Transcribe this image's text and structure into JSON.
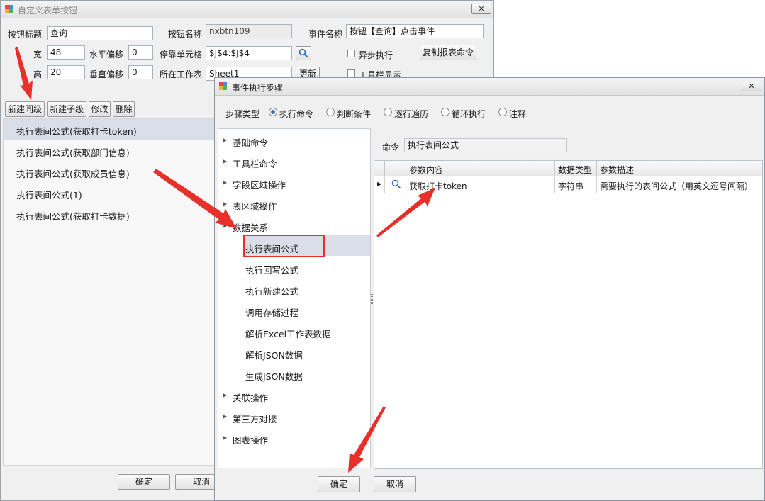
{
  "bg_window": {
    "title": "自定义表单按钮",
    "close": "✕",
    "fields": {
      "caption_label": "按钮标题",
      "caption_value": "查询",
      "name_label": "按钮名称",
      "name_value": "nxbtn109",
      "event_label": "事件名称",
      "event_value": "按钮【查询】点击事件",
      "width_label": "宽",
      "width_value": "48",
      "hoffset_label": "水平偏移",
      "hoffset_value": "0",
      "dock_label": "停靠单元格",
      "dock_value": "$J$4:$J$4",
      "async_label": "异步执行",
      "copy_cmd_label": "复制报表命令",
      "height_label": "高",
      "height_value": "20",
      "voffset_label": "垂直偏移",
      "voffset_value": "0",
      "sheet_label": "所在工作表",
      "sheet_value": "Sheet1",
      "refresh_label": "更新",
      "toolbar_label": "工具栏显示"
    },
    "toolbar": {
      "new_sibling": "新建同级",
      "new_child": "新建子级",
      "modify": "修改",
      "delete": "删除"
    },
    "steps": [
      "执行表间公式(获取打卡token)",
      "执行表间公式(获取部门信息)",
      "执行表间公式(获取成员信息)",
      "执行表间公式(1)",
      "执行表间公式(获取打卡数据)"
    ],
    "ok": "确定",
    "cancel": "取消"
  },
  "dialog": {
    "title": "事件执行步骤",
    "close": "✕",
    "step_type_label": "步骤类型",
    "step_types": [
      "执行命令",
      "判断条件",
      "逐行遍历",
      "循环执行",
      "注释"
    ],
    "step_type_selected": "执行命令",
    "tree": {
      "top": [
        "基础命令",
        "工具栏命令",
        "字段区域操作",
        "表区域操作",
        "数据关系"
      ],
      "data_relation_children": [
        "执行表间公式",
        "执行回写公式",
        "执行新建公式",
        "调用存储过程",
        "解析Excel工作表数据",
        "解析JSON数据",
        "生成JSON数据"
      ],
      "bottom": [
        "关联操作",
        "第三方对接",
        "图表操作"
      ],
      "selected": "执行表间公式"
    },
    "command_label": "命令",
    "command_value": "执行表间公式",
    "grid": {
      "headers": [
        "参数内容",
        "数据类型",
        "参数描述"
      ],
      "rows": [
        {
          "content": "获取打卡token",
          "type": "字符串",
          "desc": "需要执行的表间公式（用英文逗号间隔）"
        }
      ]
    },
    "ok": "确定",
    "cancel": "取消"
  },
  "colors": {
    "annotation_red": "#e8302a",
    "selection": "#d9dee8",
    "accent": "#3a6fb0"
  }
}
